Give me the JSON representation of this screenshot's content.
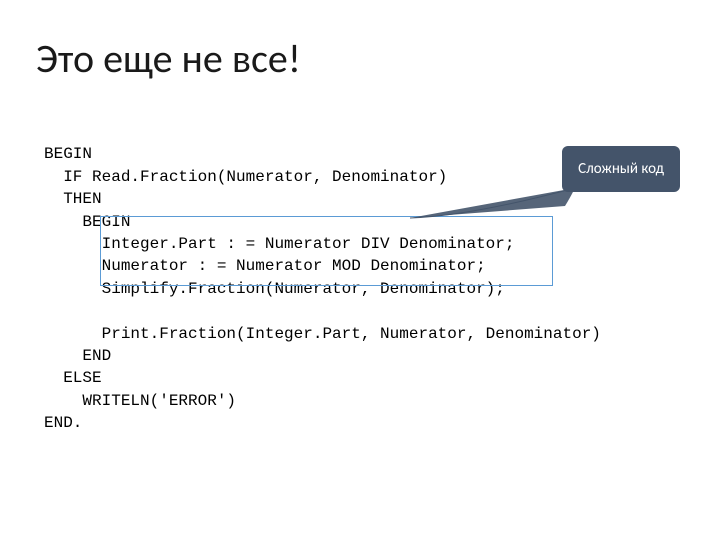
{
  "title": "Это еще не все!",
  "callout_label": "Сложный код",
  "code": {
    "l01": "BEGIN",
    "l02": "  IF Read.Fraction(Numerator, Denominator)",
    "l03": "  THEN",
    "l04": "    BEGIN",
    "l05": "      Integer.Part : = Numerator DIV Denominator;",
    "l06": "      Numerator : = Numerator MOD Denominator;",
    "l07": "      Simplify.Fraction(Numerator, Denominator);",
    "l08": "",
    "l09": "      Print.Fraction(Integer.Part, Numerator, Denominator)",
    "l10": "    END",
    "l11": "  ELSE",
    "l12": "    WRITELN('ERROR')",
    "l13": "END."
  }
}
